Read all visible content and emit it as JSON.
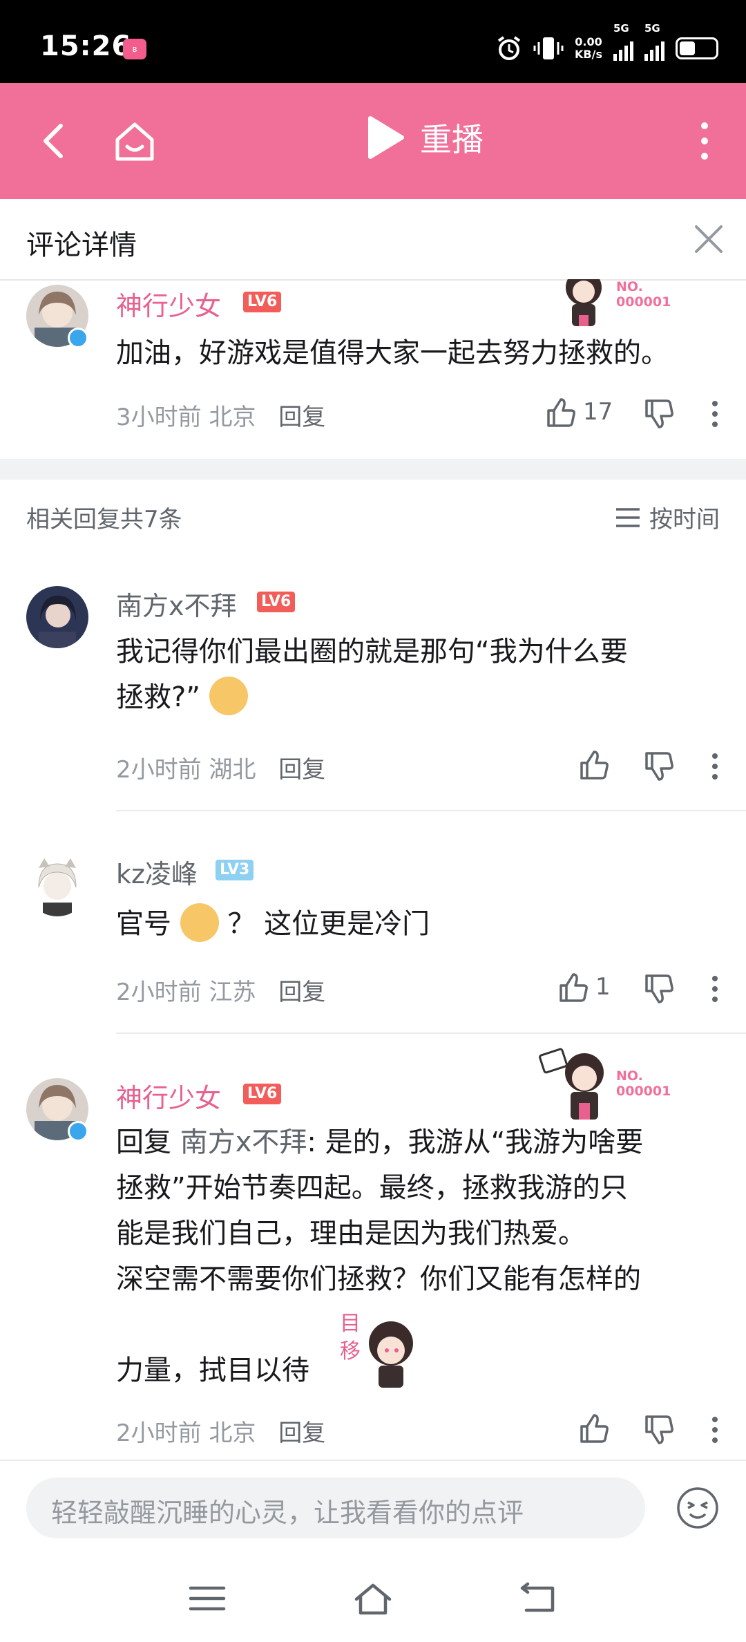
{
  "status_bar": {
    "time": "15:26",
    "app_badge": "bilibili",
    "speed_value": "0.00",
    "speed_unit": "KB/s",
    "net1": "5G",
    "net2": "5G"
  },
  "top_bar": {
    "replay_label": "重播",
    "accent": "#f07099"
  },
  "panel": {
    "title": "评论详情"
  },
  "main_comment": {
    "user": "神行少女",
    "level": "LV6",
    "text": "加油，好游戏是值得大家一起去努力拯救的。",
    "time": "3小时前",
    "location": "北京",
    "reply_label": "回复",
    "likes": "17",
    "badge_no": "NO.",
    "badge_num": "000001"
  },
  "replies_header": {
    "title": "相关回复共7条",
    "sort_label": "按时间"
  },
  "replies": [
    {
      "user": "南方x不拜",
      "level": "LV6",
      "text_line1": "我记得你们最出圈的就是那句“我为什么要",
      "text_line2": "拯救?”",
      "time": "2小时前",
      "location": "湖北",
      "reply_label": "回复",
      "likes": ""
    },
    {
      "user": "kz凌峰",
      "level": "LV3",
      "text_before": "官号",
      "text_after": "？ 这位更是冷门",
      "time": "2小时前",
      "location": "江苏",
      "reply_label": "回复",
      "likes": "1"
    },
    {
      "user": "神行少女",
      "level": "LV6",
      "reply_prefix": "回复 ",
      "mention": "南方x不拜",
      "text_line1": ": 是的，我游从“我游为啥要",
      "text_line2": "拯救”开始节奏四起。最终，拯救我游的只",
      "text_line3": "能是我们自己，理由是因为我们热爱。",
      "text_line4": "深空需不需要你们拯救？你们又能有怎样的",
      "text_line5": "力量，拭目以待",
      "time": "2小时前",
      "location": "北京",
      "reply_label": "回复",
      "likes": "",
      "badge_no": "NO.",
      "badge_num": "000001",
      "sticker_text": "目移"
    }
  ],
  "input": {
    "placeholder": "轻轻敲醒沉睡的心灵，让我看看你的点评"
  }
}
